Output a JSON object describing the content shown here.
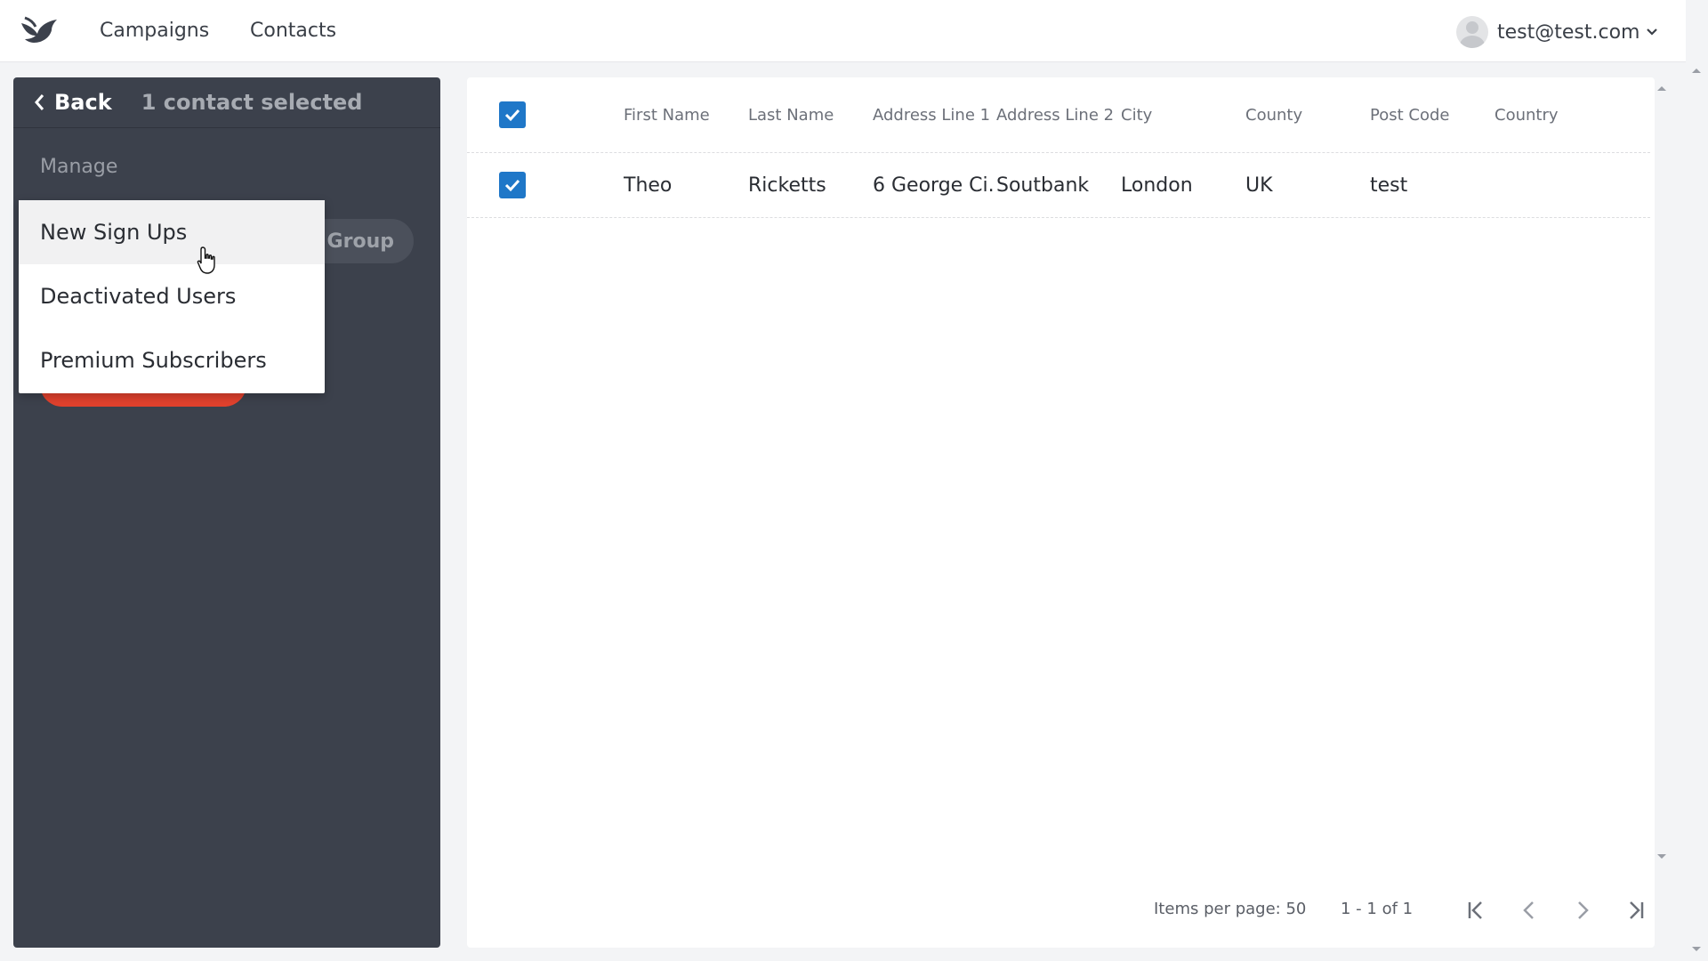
{
  "nav": {
    "campaigns": "Campaigns",
    "contacts": "Contacts",
    "user_email": "test@test.com"
  },
  "sidebar": {
    "back_label": "Back",
    "selected_text": "1 contact selected",
    "section_title": "Manage",
    "group_button_visible_text": "o Group"
  },
  "dropdown": {
    "items": [
      {
        "label": "New Sign Ups"
      },
      {
        "label": "Deactivated Users"
      },
      {
        "label": "Premium Subscribers"
      }
    ]
  },
  "table": {
    "headers": [
      "First Name",
      "Last Name",
      "Address Line 1",
      "Address Line 2",
      "City",
      "County",
      "Post Code",
      "Country"
    ],
    "rows": [
      [
        "Theo",
        "Ricketts",
        "6 George Ci...",
        "Soutbank",
        "London",
        "UK",
        "test",
        ""
      ]
    ]
  },
  "paginator": {
    "items_per_page": "Items per page: 50",
    "range": "1 - 1 of 1"
  },
  "colors": {
    "sidebar_bg": "#3c414c",
    "accent": "#1f77c8",
    "danger": "#e0412d"
  }
}
